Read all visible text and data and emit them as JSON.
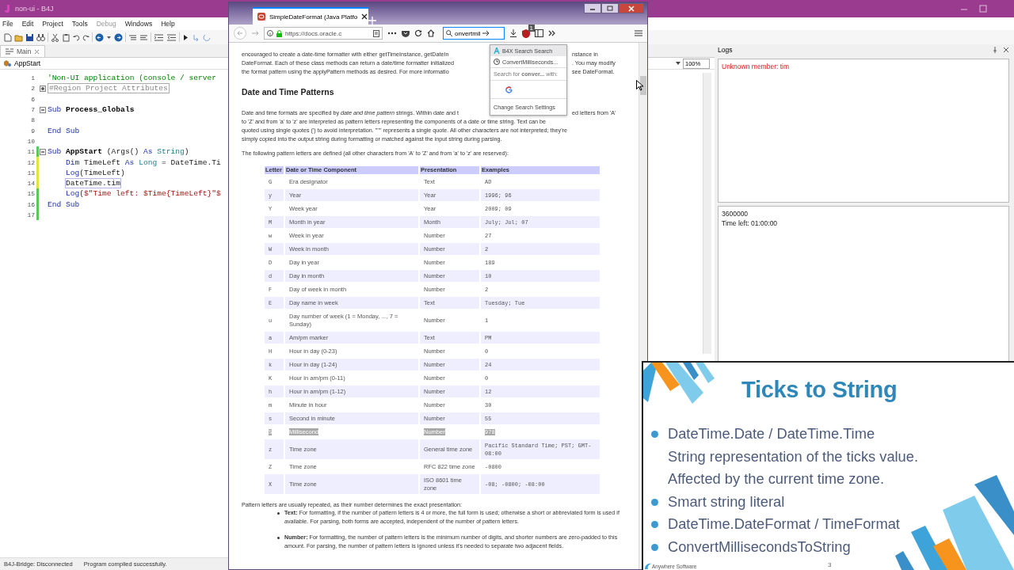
{
  "ide": {
    "title": "non-ui - B4J",
    "menu": [
      {
        "label": "File",
        "disabled": false
      },
      {
        "label": "Edit",
        "disabled": false
      },
      {
        "label": "Project",
        "disabled": false
      },
      {
        "label": "Tools",
        "disabled": false
      },
      {
        "label": "Debug",
        "disabled": true
      },
      {
        "label": "Windows",
        "disabled": false
      },
      {
        "label": "Help",
        "disabled": false
      }
    ],
    "editor_tab": {
      "label": "Main",
      "selected": true
    },
    "module": "AppStart",
    "code": [
      {
        "line": "1",
        "tokens": [
          {
            "text": "'Non-UI application (console / server",
            "kind": "comment"
          }
        ]
      },
      {
        "line": "2",
        "expanded": false,
        "tokens": [
          {
            "text": "#Region Project Attributes",
            "kind": "region"
          }
        ]
      },
      {
        "line": "6"
      },
      {
        "line": "7",
        "expanded": true,
        "tokens": [
          {
            "text": "Sub",
            "kind": "keyword"
          },
          {
            "text": " Process_Globals",
            "kind": "name"
          }
        ]
      },
      {
        "line": "8"
      },
      {
        "line": "9",
        "tokens": [
          {
            "text": "End Sub",
            "kind": "keyword"
          }
        ]
      },
      {
        "line": "10"
      },
      {
        "line": "11",
        "color": "#5cc55c",
        "expanded": true,
        "tokens": [
          {
            "text": "Sub",
            "kind": "keyword"
          },
          {
            "text": " AppStart",
            "kind": "name"
          },
          {
            "text": " (Args() ",
            "kind": "plain"
          },
          {
            "text": "As",
            "kind": "keyword"
          },
          {
            "text": " String",
            "kind": "type"
          },
          {
            "text": ")",
            "kind": "plain"
          }
        ]
      },
      {
        "line": "12",
        "color": "#e8e040",
        "indented": true,
        "tokens": [
          {
            "text": "Dim",
            "kind": "keyword"
          },
          {
            "text": " TimeLeft ",
            "kind": "plain"
          },
          {
            "text": "As",
            "kind": "keyword"
          },
          {
            "text": " Long",
            "kind": "type"
          },
          {
            "text": " = DateTime.Ti",
            "kind": "plain"
          }
        ]
      },
      {
        "line": "13",
        "color": "#e8e040",
        "indented": true,
        "tokens": [
          {
            "text": "Log",
            "kind": "keyword"
          },
          {
            "text": "(TimeLeft)",
            "kind": "plain"
          }
        ]
      },
      {
        "line": "14",
        "color": "#e8e040",
        "indented": true,
        "current": true,
        "tokens": [
          {
            "text": "DateTime.tim",
            "kind": "plain"
          }
        ]
      },
      {
        "line": "15",
        "color": "#5cc55c",
        "indented": true,
        "tokens": [
          {
            "text": "Log",
            "kind": "keyword"
          },
          {
            "text": "(",
            "kind": "plain"
          },
          {
            "text": "$\"Time left: $Time{TimeLeft}\"$",
            "kind": "string"
          }
        ]
      },
      {
        "line": "16",
        "color": "#5cc55c",
        "tokens": [
          {
            "text": "End Sub",
            "kind": "keyword"
          }
        ]
      },
      {
        "line": "17",
        "color": "#5cc55c"
      }
    ],
    "zoom": "100%",
    "logs": {
      "title": "Logs",
      "errors": [
        "Unknown member: tim"
      ],
      "output": [
        "3600000",
        "Time left: 01:00:00"
      ]
    },
    "status_bar": [
      "B4J-Bridge: Disconnected",
      "Program compiled successfully."
    ]
  },
  "browser": {
    "tab": {
      "title": "SimpleDateFormat (Java Platfo",
      "selected": true
    },
    "url": "https://docs.oracle.c",
    "search": {
      "value": "onvertmil"
    },
    "badge": "1",
    "search_menu": {
      "engine": "B4X Search Search",
      "history": "ConvertMilliseconds...",
      "search_for": "Search for **conver...** with:",
      "settings": "Change Search Settings"
    },
    "page": {
      "intro_lines": [
        {
          "left": "encouraged to create a date-time formatter with either getTimeInstance, getDateIn",
          "right": "nstance in"
        },
        {
          "left": "DateFormat. Each of these class methods can return a date/time formatter initialized",
          "right": ". You may modify"
        },
        {
          "left": "the format pattern using the applyPattern methods as desired. For more informatio",
          "right": "see DateFormat."
        }
      ],
      "heading": "Date and Time Patterns",
      "pattern_lines": [
        {
          "left": "Date and time formats are specified by *date and time pattern* strings. Within date and t",
          "right": "ed letters from 'A'"
        },
        {
          "left": "to 'Z' and from 'a' to 'z' are interpreted as pattern letters representing the components of a date or time string. Text can be"
        },
        {
          "left": "quoted using single quotes (') to avoid interpretation. \"''\" represents a single quote. All other characters are not interpreted; they're"
        },
        {
          "left": "simply copied into the output string during formatting or matched against the input string during parsing."
        }
      ],
      "table_intro": "The following pattern letters are defined (all other characters from 'A' to 'Z' and from 'a' to 'z' are reserved):",
      "table": {
        "columns": [
          "Letter",
          "Date or Time Component",
          "Presentation",
          "Examples"
        ],
        "rows": [
          {
            "cells": [
              "G",
              "Era designator",
              "Text",
              "AD"
            ],
            "selected": false
          },
          {
            "cells": [
              "y",
              "Year",
              "Year",
              "1996; 96"
            ],
            "selected": false
          },
          {
            "cells": [
              "Y",
              "Week year",
              "Year",
              "2009; 09"
            ],
            "selected": false
          },
          {
            "cells": [
              "M",
              "Month in year",
              "Month",
              "July; Jul; 07"
            ],
            "selected": false
          },
          {
            "cells": [
              "w",
              "Week in year",
              "Number",
              "27"
            ],
            "selected": false
          },
          {
            "cells": [
              "W",
              "Week in month",
              "Number",
              "2"
            ],
            "selected": false
          },
          {
            "cells": [
              "D",
              "Day in year",
              "Number",
              "189"
            ],
            "selected": false
          },
          {
            "cells": [
              "d",
              "Day in month",
              "Number",
              "10"
            ],
            "selected": false
          },
          {
            "cells": [
              "F",
              "Day of week in month",
              "Number",
              "2"
            ],
            "selected": false
          },
          {
            "cells": [
              "E",
              "Day name in week",
              "Text",
              "Tuesday; Tue"
            ],
            "selected": false
          },
          {
            "cells": [
              "u",
              "Day number of week (1 = Monday, ..., 7 = Sunday)",
              "Number",
              "1"
            ],
            "selected": false
          },
          {
            "cells": [
              "a",
              "Am/pm marker",
              "Text",
              "PM"
            ],
            "selected": false
          },
          {
            "cells": [
              "H",
              "Hour in day (0-23)",
              "Number",
              "0"
            ],
            "selected": false
          },
          {
            "cells": [
              "k",
              "Hour in day (1-24)",
              "Number",
              "24"
            ],
            "selected": false
          },
          {
            "cells": [
              "K",
              "Hour in am/pm (0-11)",
              "Number",
              "0"
            ],
            "selected": false
          },
          {
            "cells": [
              "h",
              "Hour in am/pm (1-12)",
              "Number",
              "12"
            ],
            "selected": false
          },
          {
            "cells": [
              "m",
              "Minute in hour",
              "Number",
              "30"
            ],
            "selected": false
          },
          {
            "cells": [
              "s",
              "Second in minute",
              "Number",
              "55"
            ],
            "selected": false
          },
          {
            "cells": [
              "S",
              "Millisecond",
              "Number",
              "978"
            ],
            "selected": true
          },
          {
            "cells": [
              "z",
              "Time zone",
              "General time zone",
              "Pacific Standard Time; PST; GMT-08:00"
            ],
            "selected": false
          },
          {
            "cells": [
              "Z",
              "Time zone",
              "RFC 822 time zone",
              "-0800"
            ],
            "selected": false
          },
          {
            "cells": [
              "X",
              "Time zone",
              "ISO 8601 time zone",
              "-08; -0800; -08:00"
            ],
            "selected": false
          }
        ]
      },
      "outro": "Pattern letters are usually repeated, as their number determines the exact presentation:",
      "bullets": [
        "**Text:** For formatting, if the number of pattern letters is 4 or more, the full form is used; otherwise a short or abbreviated form is used if available. For parsing, both forms are accepted, independent of the number of pattern letters.",
        "**Number:** For formatting, the number of pattern letters is the minimum number of digits, and shorter numbers are zero-padded to this amount. For parsing, the number of pattern letters is ignored unless it's needed to separate two adjacent fields."
      ]
    }
  },
  "slide": {
    "title": "Ticks to String",
    "bullets": [
      {
        "lines": [
          "DateTime.Date / DateTime.Time",
          "String representation of the ticks value.",
          "Affected by the current time zone."
        ]
      },
      {
        "lines": [
          "Smart string literal"
        ]
      },
      {
        "lines": [
          "DateTime.DateFormat / TimeFormat"
        ]
      },
      {
        "lines": [
          "ConvertMillisecondsToString"
        ]
      }
    ],
    "footer": "Anywhere Software",
    "page": "3"
  }
}
